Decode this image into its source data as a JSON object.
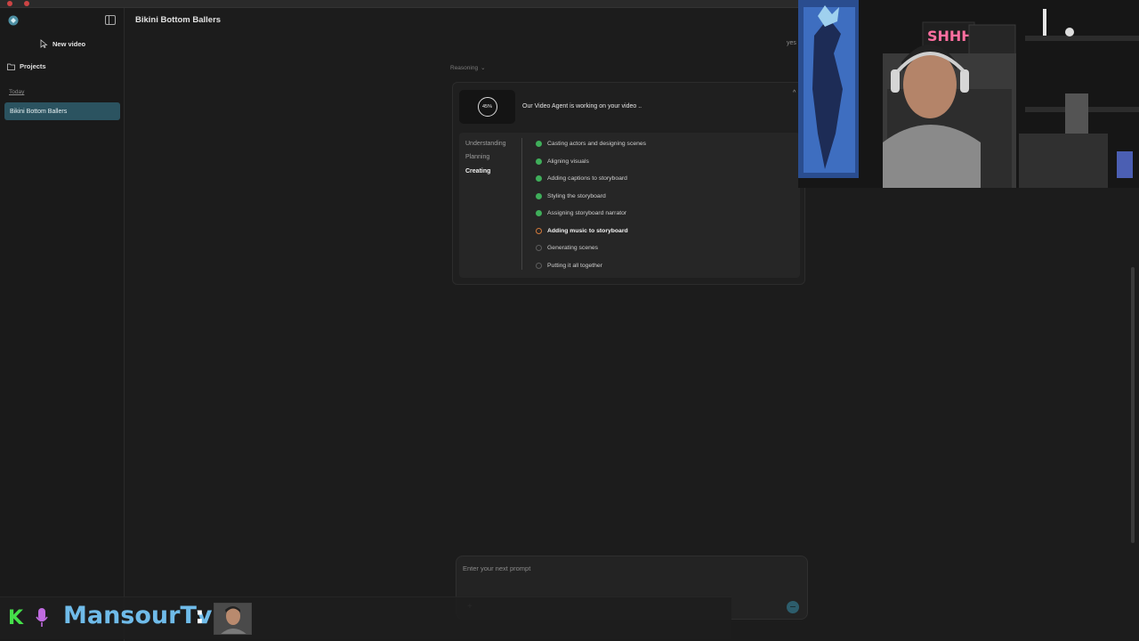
{
  "sidebar": {
    "new_video": "New video",
    "projects": "Projects",
    "section_today": "Today",
    "active_item": "Bikini Bottom Ballers"
  },
  "main": {
    "title": "Bikini Bottom Ballers",
    "user_message": "yes",
    "reasoning_label": "Reasoning",
    "progress": "45%",
    "status": "Our Video Agent is working on your video ..",
    "phases": [
      "Understanding",
      "Planning",
      "Creating"
    ],
    "active_phase": "Creating",
    "steps": [
      {
        "label": "Casting actors and designing scenes",
        "state": "done"
      },
      {
        "label": "Aligning visuals",
        "state": "done"
      },
      {
        "label": "Adding captions to storyboard",
        "state": "done"
      },
      {
        "label": "Styling the storyboard",
        "state": "done"
      },
      {
        "label": "Assigning storyboard narrator",
        "state": "done"
      },
      {
        "label": "Adding music to storyboard",
        "state": "in-progress"
      },
      {
        "label": "Generating scenes",
        "state": "pending"
      },
      {
        "label": "Putting it all together",
        "state": "pending"
      }
    ]
  },
  "prompt": {
    "placeholder": "Enter your next prompt"
  },
  "stream_overlay": {
    "channel_name": "MansourTv",
    "separator": ":",
    "kick_letter": "K",
    "webcam_sign": "SHHH!"
  },
  "colors": {
    "accent": "#2b5360",
    "done": "#3fae5a",
    "in_progress": "#d2793b",
    "channel_text": "#6fbbe9",
    "kick_green": "#45e04a"
  }
}
